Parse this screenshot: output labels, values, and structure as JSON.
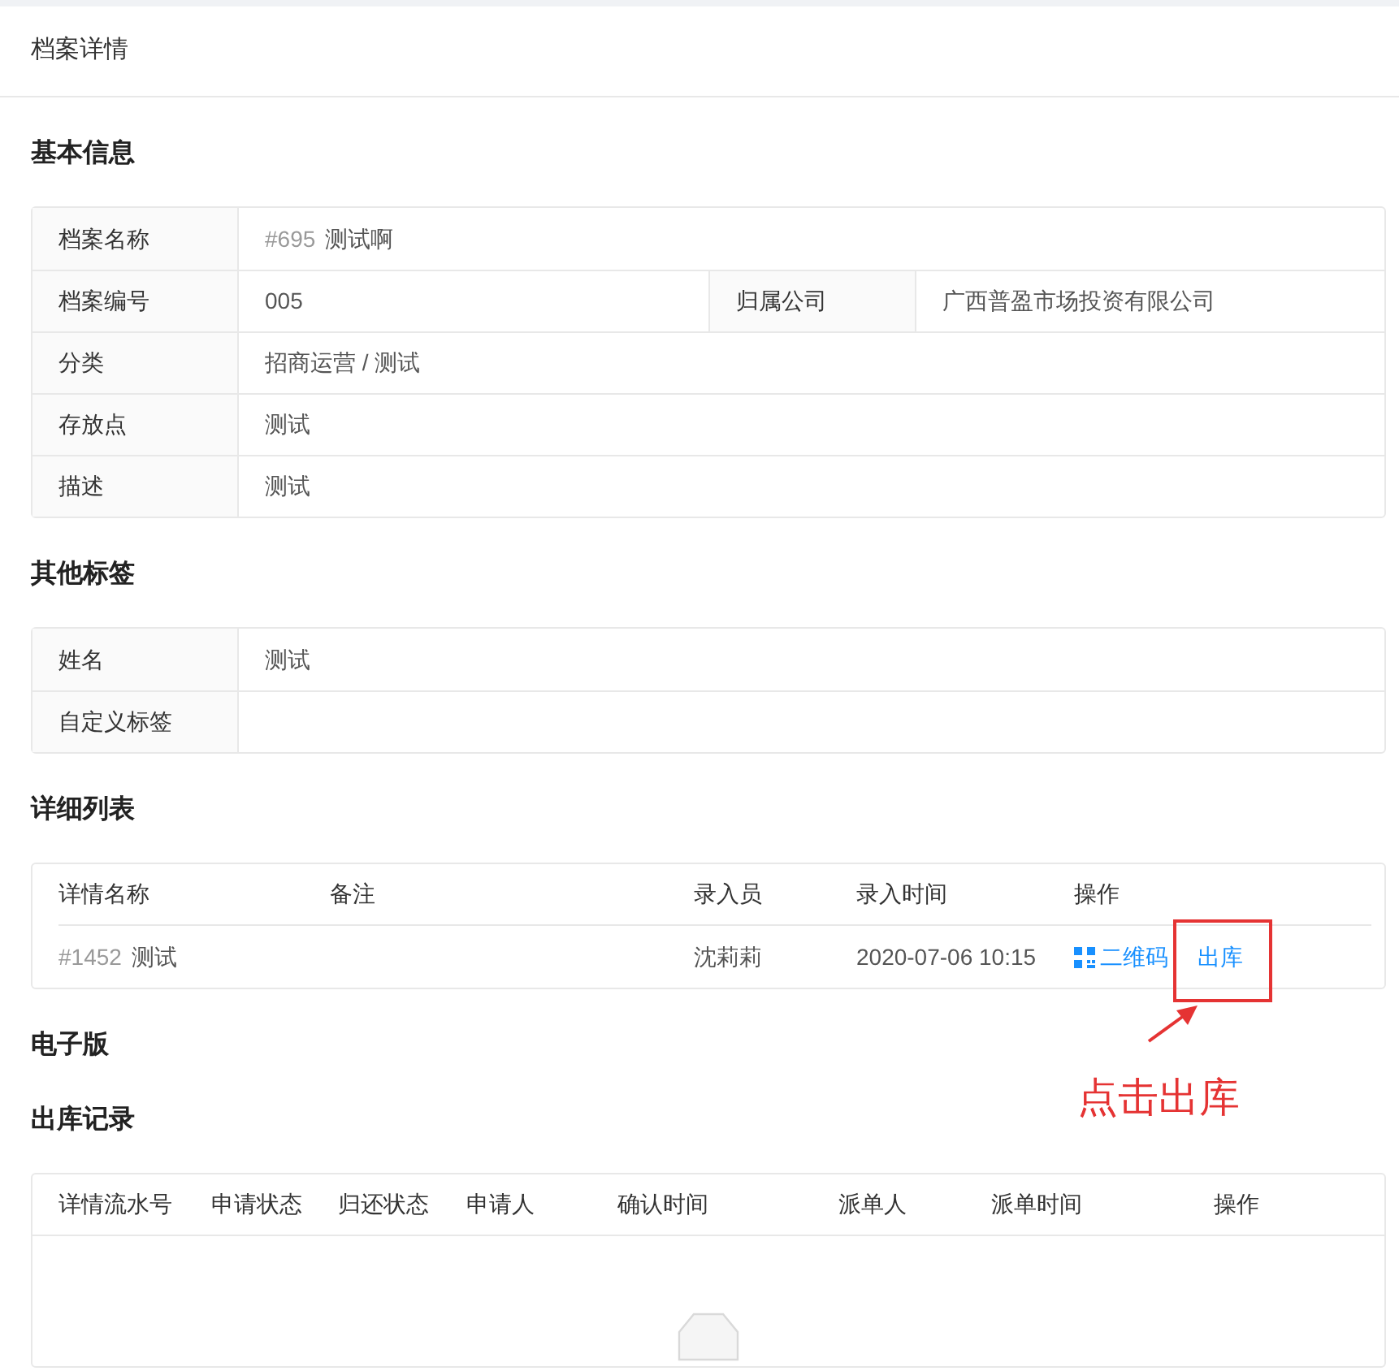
{
  "page_title": "档案详情",
  "basic_info": {
    "title": "基本信息",
    "rows": [
      [
        {
          "label": "档案名称",
          "id": "#695",
          "value": "测试啊"
        }
      ],
      [
        {
          "label": "档案编号",
          "value": "005"
        },
        {
          "label": "归属公司",
          "value": "广西普盈市场投资有限公司"
        }
      ],
      [
        {
          "label": "分类",
          "value": "招商运营 / 测试"
        }
      ],
      [
        {
          "label": "存放点",
          "value": "测试"
        }
      ],
      [
        {
          "label": "描述",
          "value": "测试"
        }
      ]
    ]
  },
  "other_tags": {
    "title": "其他标签",
    "rows": [
      [
        {
          "label": "姓名",
          "value": "测试"
        }
      ],
      [
        {
          "label": "自定义标签"
        }
      ]
    ]
  },
  "detail_list": {
    "title": "详细列表",
    "columns": [
      "详情名称",
      "备注",
      "录入员",
      "录入时间",
      "操作"
    ],
    "rows": [
      {
        "id": "#1452",
        "name": "测试",
        "operator": "沈莉莉",
        "time": "2020-07-06 10:15",
        "actions": [
          {
            "kind": "qrcode",
            "label": "二维码"
          },
          {
            "kind": "link",
            "label": "出库"
          }
        ]
      }
    ]
  },
  "electronic": {
    "title": "电子版"
  },
  "outbound_records": {
    "title": "出库记录",
    "columns": [
      "详情流水号",
      "申请状态",
      "归还状态",
      "申请人",
      "确认时间",
      "派单人",
      "派单时间",
      "操作"
    ]
  },
  "annotation": {
    "text": "点击出库"
  }
}
